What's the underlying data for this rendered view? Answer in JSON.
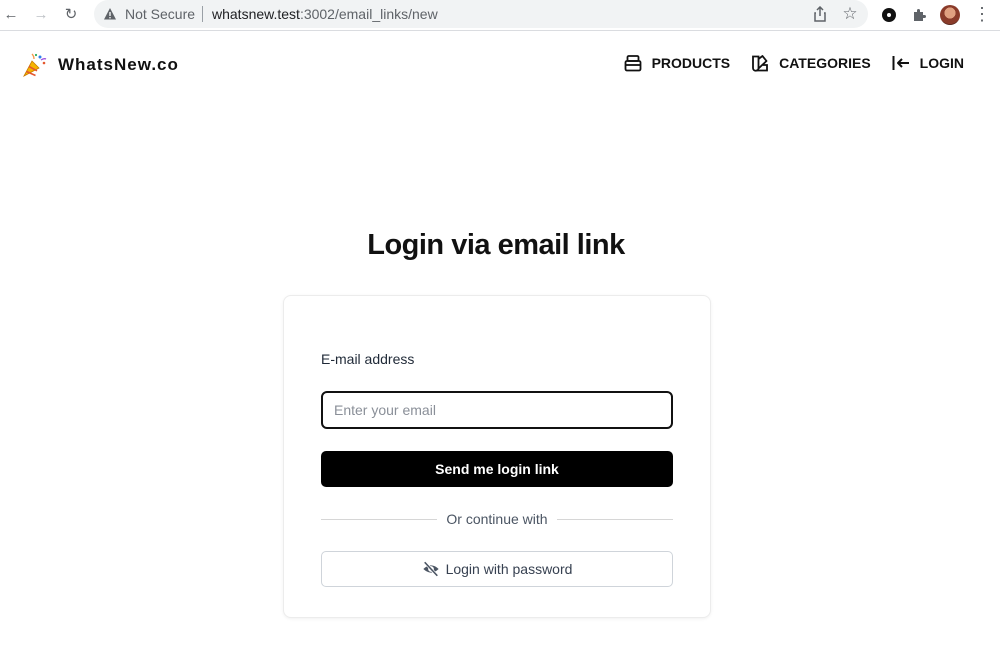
{
  "browser": {
    "security_label": "Not Secure",
    "url_host": "whatsnew.test",
    "url_rest": ":3002/email_links/new"
  },
  "site": {
    "brand": "WhatsNew.co",
    "nav": [
      {
        "label": "PRODUCTS",
        "icon": "box-icon"
      },
      {
        "label": "CATEGORIES",
        "icon": "swatch-icon"
      },
      {
        "label": "LOGIN",
        "icon": "login-arrow-icon"
      }
    ]
  },
  "main": {
    "title": "Login via email link",
    "email_label": "E-mail address",
    "email_placeholder": "Enter your email",
    "email_value": "",
    "submit_label": "Send me login link",
    "divider_text": "Or continue with",
    "password_button_label": "Login with password",
    "password_button_icon": "eye-off-icon"
  },
  "colors": {
    "primary_button": "#000000",
    "input_border": "#111111",
    "divider": "#d6d6d6"
  }
}
